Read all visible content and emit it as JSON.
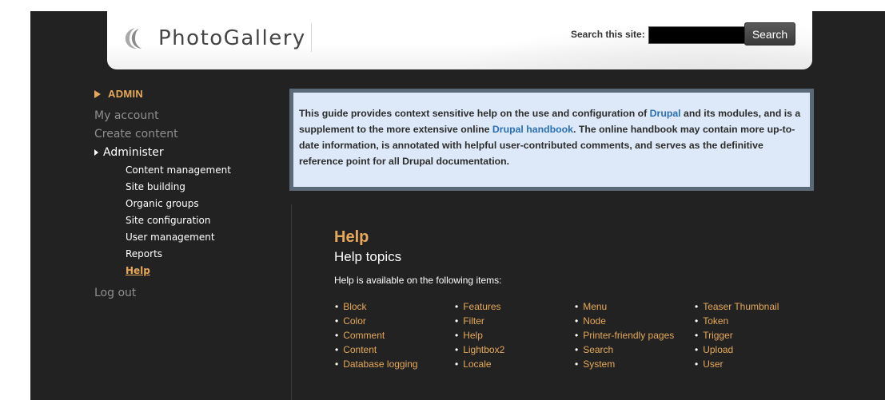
{
  "header": {
    "logo_text": "PhotoGallery",
    "search_label": "Search this site:",
    "search_value": "",
    "search_button": "Search"
  },
  "sidebar": {
    "block_title": "ADMIN",
    "links": [
      "My account",
      "Create content"
    ],
    "administer_label": "Administer",
    "admin_items": [
      "Content management",
      "Site building",
      "Organic groups",
      "Site configuration",
      "User management",
      "Reports",
      "Help"
    ],
    "active_item": "Help",
    "logout": "Log out"
  },
  "intro": {
    "segments": [
      {
        "text": "This guide provides context sensitive help on the use and configuration of ",
        "link": false
      },
      {
        "text": "Drupal",
        "link": true
      },
      {
        "text": " and its modules, and is a supplement to the more extensive online ",
        "link": false
      },
      {
        "text": "Drupal handbook",
        "link": true
      },
      {
        "text": ". The online handbook may contain more up-to-date information, is annotated with helpful user-contributed comments, and serves as the definitive reference point for all Drupal documentation.",
        "link": false
      }
    ]
  },
  "help": {
    "title": "Help",
    "subtitle": "Help topics",
    "intro": "Help is available on the following items:",
    "columns": [
      [
        "Block",
        "Color",
        "Comment",
        "Content",
        "Database logging"
      ],
      [
        "Features",
        "Filter",
        "Help",
        "Lightbox2",
        "Locale"
      ],
      [
        "Menu",
        "Node",
        "Printer-friendly pages",
        "Search",
        "System"
      ],
      [
        "Teaser Thumbnail",
        "Token",
        "Trigger",
        "Upload",
        "User"
      ]
    ]
  },
  "colors": {
    "accent": "#e6a85a",
    "background": "#222222",
    "intro_bg": "#dde9f8",
    "link": "#2a6fb4"
  }
}
